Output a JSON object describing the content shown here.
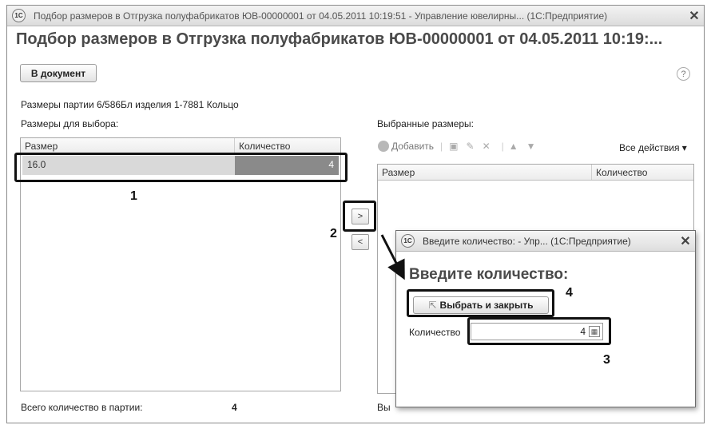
{
  "window": {
    "title": "Подбор размеров в Отгрузка полуфабрикатов ЮВ-00000001 от 04.05.2011 10:19:51 - Управление ювелирны... (1С:Предприятие)",
    "logo": "1С",
    "close": "✕"
  },
  "form": {
    "heading": "Подбор размеров в Отгрузка полуфабрикатов ЮВ-00000001 от 04.05.2011 10:19:...",
    "to_document_button": "В документ",
    "help": "?",
    "batch_info": "Размеры партии 6/586Бл изделия 1-7881 Кольцо"
  },
  "left_panel": {
    "title": "Размеры для выбора:",
    "columns": [
      "Размер",
      "Количество"
    ],
    "rows": [
      {
        "size": "16.0",
        "qty": "4"
      }
    ],
    "total_label": "Всего количество в партии:",
    "total_value": "4"
  },
  "transfer": {
    "right_arrow": ">",
    "left_arrow": "<"
  },
  "right_panel": {
    "title": "Выбранные размеры:",
    "add_label": "Добавить",
    "all_actions": "Все действия ▾",
    "columns": [
      "Размер",
      "Количество"
    ],
    "total_label_partial": "Вы"
  },
  "dialog": {
    "title": "Введите количество: - Упр...  (1С:Предприятие)",
    "logo": "1С",
    "close": "✕",
    "heading": "Введите количество:",
    "select_close_button": "Выбрать и закрыть",
    "quantity_label": "Количество",
    "quantity_value": "4"
  },
  "annotations": [
    "1",
    "2",
    "3",
    "4"
  ]
}
